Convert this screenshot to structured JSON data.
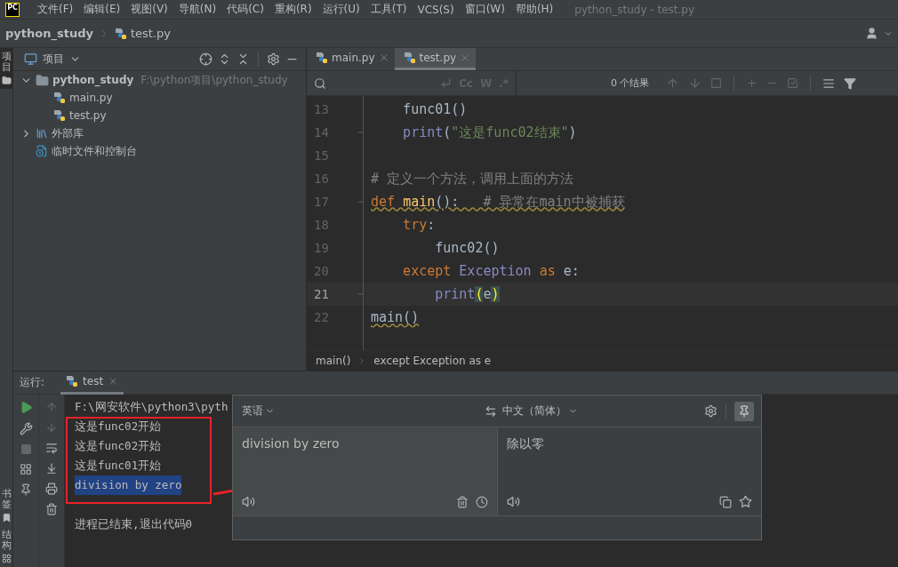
{
  "menu_bar": {
    "logo": "PC",
    "items": [
      "文件(F)",
      "编辑(E)",
      "视图(V)",
      "导航(N)",
      "代码(C)",
      "重构(R)",
      "运行(U)",
      "工具(T)",
      "VCS(S)",
      "窗口(W)",
      "帮助(H)"
    ],
    "title": "python_study - test.py"
  },
  "nav_bar": {
    "crumbs": [
      {
        "label": "python_study",
        "kind": "project"
      },
      {
        "label": "test.py",
        "kind": "file"
      }
    ]
  },
  "side_strip": {
    "top": [
      {
        "label": "项目",
        "selected": true
      }
    ],
    "bottom": [
      {
        "label": "书签",
        "kind": "bookmarks"
      },
      {
        "label": "结构",
        "kind": "structure"
      }
    ]
  },
  "project_panel": {
    "title": "项目",
    "tree": [
      {
        "label": "python_study",
        "kind": "folder",
        "path": "F:\\python项目\\python_study",
        "expanded": true,
        "children": [
          {
            "label": "main.py",
            "kind": "python"
          },
          {
            "label": "test.py",
            "kind": "python"
          }
        ]
      },
      {
        "label": "外部库",
        "kind": "library",
        "expanded": false
      },
      {
        "label": "临时文件和控制台",
        "kind": "scratch"
      }
    ]
  },
  "editor": {
    "tabs": [
      {
        "label": "main.py",
        "selected": false
      },
      {
        "label": "test.py",
        "selected": true
      }
    ],
    "find_bar": {
      "toggles": [
        "Cc",
        "W",
        ".*"
      ],
      "results": "0 个结果"
    },
    "lines": [
      {
        "number": "13",
        "tokens": [
          {
            "text": "    func01()",
            "kind": "plain"
          }
        ]
      },
      {
        "number": "14",
        "fold": true,
        "tokens": [
          {
            "text": "    print",
            "kind": "builtin"
          },
          {
            "text": "(",
            "kind": "plain"
          },
          {
            "text": "\"这是func02结束\"",
            "kind": "string"
          },
          {
            "text": ")",
            "kind": "plain"
          }
        ]
      },
      {
        "number": "15"
      },
      {
        "number": "16",
        "tokens": [
          {
            "text": "# 定义一个方法，调用上面的方法",
            "kind": "comment"
          }
        ]
      },
      {
        "number": "17",
        "fold": true,
        "warning": true,
        "tokens": [
          {
            "text": "def ",
            "kind": "keyword"
          },
          {
            "text": "main",
            "kind": "function"
          },
          {
            "text": "():   ",
            "kind": "plain"
          },
          {
            "text": "# 异常在main中被捕获",
            "kind": "comment"
          }
        ]
      },
      {
        "number": "18",
        "tokens": [
          {
            "text": "    try",
            "kind": "keyword"
          },
          {
            "text": ":",
            "kind": "plain"
          }
        ]
      },
      {
        "number": "19",
        "tokens": [
          {
            "text": "        func02()",
            "kind": "plain"
          }
        ]
      },
      {
        "number": "20",
        "tokens": [
          {
            "text": "    except ",
            "kind": "keyword"
          },
          {
            "text": "Exception ",
            "kind": "class"
          },
          {
            "text": "as",
            "kind": "keyword"
          },
          {
            "text": " e:",
            "kind": "plain"
          }
        ]
      },
      {
        "number": "21",
        "fold": true,
        "current": true,
        "tokens": [
          {
            "text": "        print",
            "kind": "builtin"
          },
          {
            "text": "(",
            "kind": "brace"
          },
          {
            "text": "e",
            "kind": "plain"
          },
          {
            "text": ")",
            "kind": "brace"
          }
        ]
      },
      {
        "number": "22",
        "warning": true,
        "tokens": [
          {
            "text": "main()",
            "kind": "plain"
          }
        ]
      }
    ],
    "breadcrumbs": [
      "main()",
      "except Exception as e"
    ]
  },
  "run_panel": {
    "label": "运行:",
    "tabs": [
      {
        "label": "test",
        "selected": true
      }
    ],
    "console": [
      {
        "text": "F:\\网安软件\\python3\\pyth",
        "kind": "command",
        "selected": false
      },
      {
        "text": "这是func02开始",
        "kind": "output",
        "selected": false
      },
      {
        "text": "这是func02开始",
        "kind": "output",
        "selected": false
      },
      {
        "text": "这是func01开始",
        "kind": "output",
        "selected": false
      },
      {
        "text": "division by zero",
        "kind": "output",
        "selected": true
      },
      {
        "text": "进程已结束,退出代码0",
        "kind": "exit",
        "selected": false
      }
    ]
  },
  "translator": {
    "source_language": "英语",
    "target_language": "中文（简体）",
    "pinned": true,
    "source_text": "division by zero",
    "target_text": "除以零"
  }
}
